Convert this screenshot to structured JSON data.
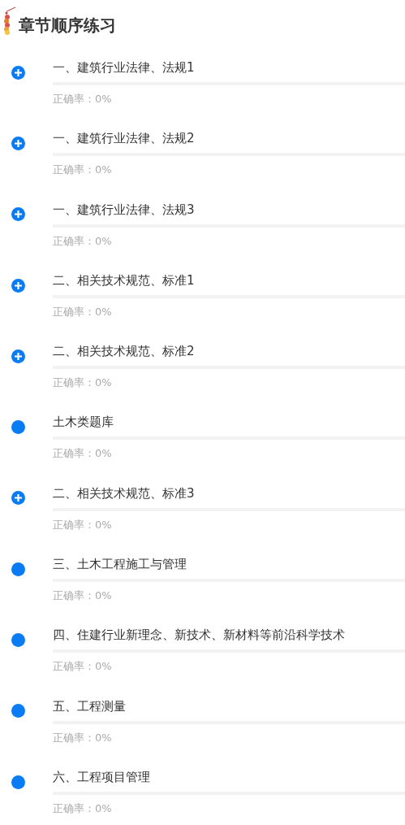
{
  "title": "章节顺序练习",
  "chapters": [
    {
      "name": "一、建筑行业法律、法规1",
      "kind": "expandable",
      "accuracy": "正确率：0%"
    },
    {
      "name": "一、建筑行业法律、法规2",
      "kind": "expandable",
      "accuracy": "正确率：0%"
    },
    {
      "name": "一、建筑行业法律、法规3",
      "kind": "expandable",
      "accuracy": "正确率：0%"
    },
    {
      "name": "二、相关技术规范、标准1",
      "kind": "expandable",
      "accuracy": "正确率：0%"
    },
    {
      "name": "二、相关技术规范、标准2",
      "kind": "expandable",
      "accuracy": "正确率：0%"
    },
    {
      "name": "土木类题库",
      "kind": "leaf",
      "accuracy": "正确率：0%"
    },
    {
      "name": "二、相关技术规范、标准3",
      "kind": "expandable",
      "accuracy": "正确率：0%"
    },
    {
      "name": "三、土木工程施工与管理",
      "kind": "leaf",
      "accuracy": "正确率：0%"
    },
    {
      "name": "四、住建行业新理念、新技术、新材料等前沿科学技术",
      "kind": "leaf",
      "accuracy": "正确率：0%"
    },
    {
      "name": "五、工程测量",
      "kind": "leaf",
      "accuracy": "正确率：0%"
    },
    {
      "name": "六、工程项目管理",
      "kind": "leaf",
      "accuracy": "正确率：0%"
    }
  ]
}
